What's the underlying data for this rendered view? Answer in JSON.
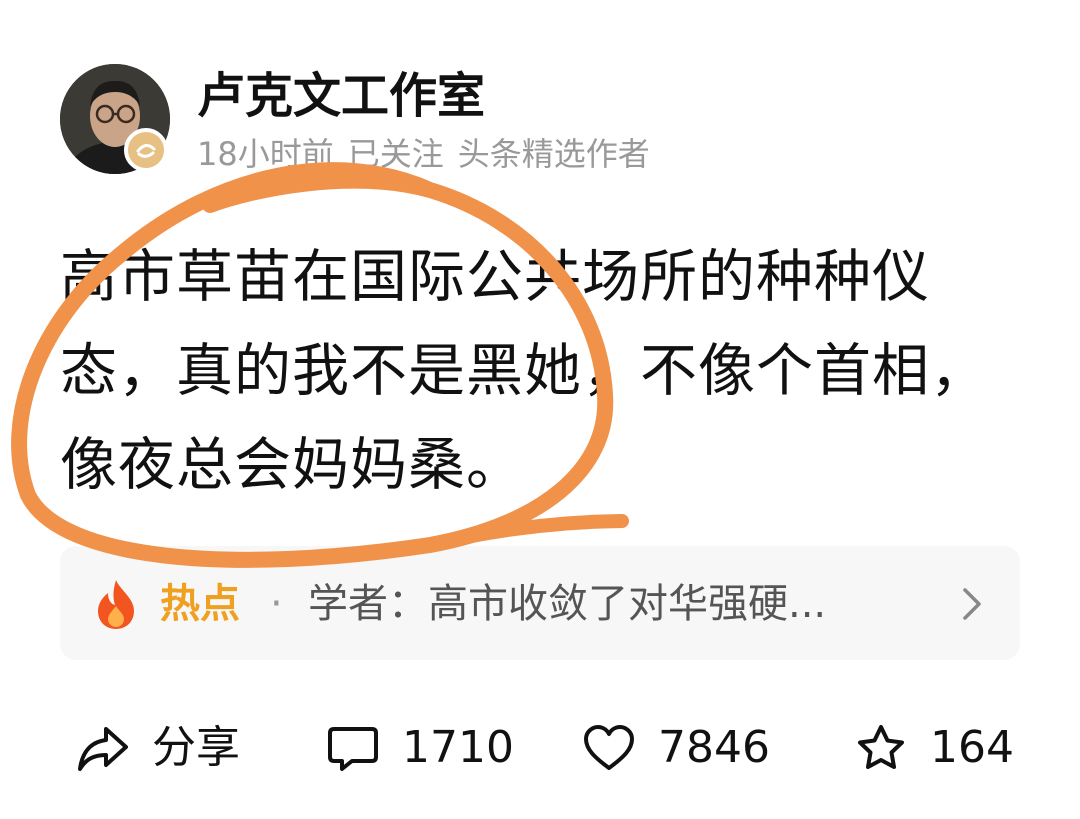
{
  "author": {
    "name": "卢克文工作室",
    "time": "18小时前",
    "follow_status": "已关注",
    "tag": "头条精选作者"
  },
  "post": {
    "text": "高市草苗在国际公共场所的种种仪态，真的我不是黑她，不像个首相，像夜总会妈妈桑。"
  },
  "hot_topic": {
    "label": "热点",
    "separator": "·",
    "headline": "学者：高市收敛了对华强硬..."
  },
  "actions": {
    "share_label": "分享",
    "comment_count": "1710",
    "like_count": "7846",
    "favorite_count": "164"
  },
  "colors": {
    "annotation_stroke": "#f0924a",
    "hot_label": "#f0a020",
    "hot_flame": "#f2551f",
    "badge": "#e7c183",
    "meta_text": "#999999"
  },
  "icons": [
    "verified-badge-icon",
    "flame-icon",
    "chevron-right-icon",
    "share-icon",
    "comment-icon",
    "heart-icon",
    "star-icon"
  ]
}
